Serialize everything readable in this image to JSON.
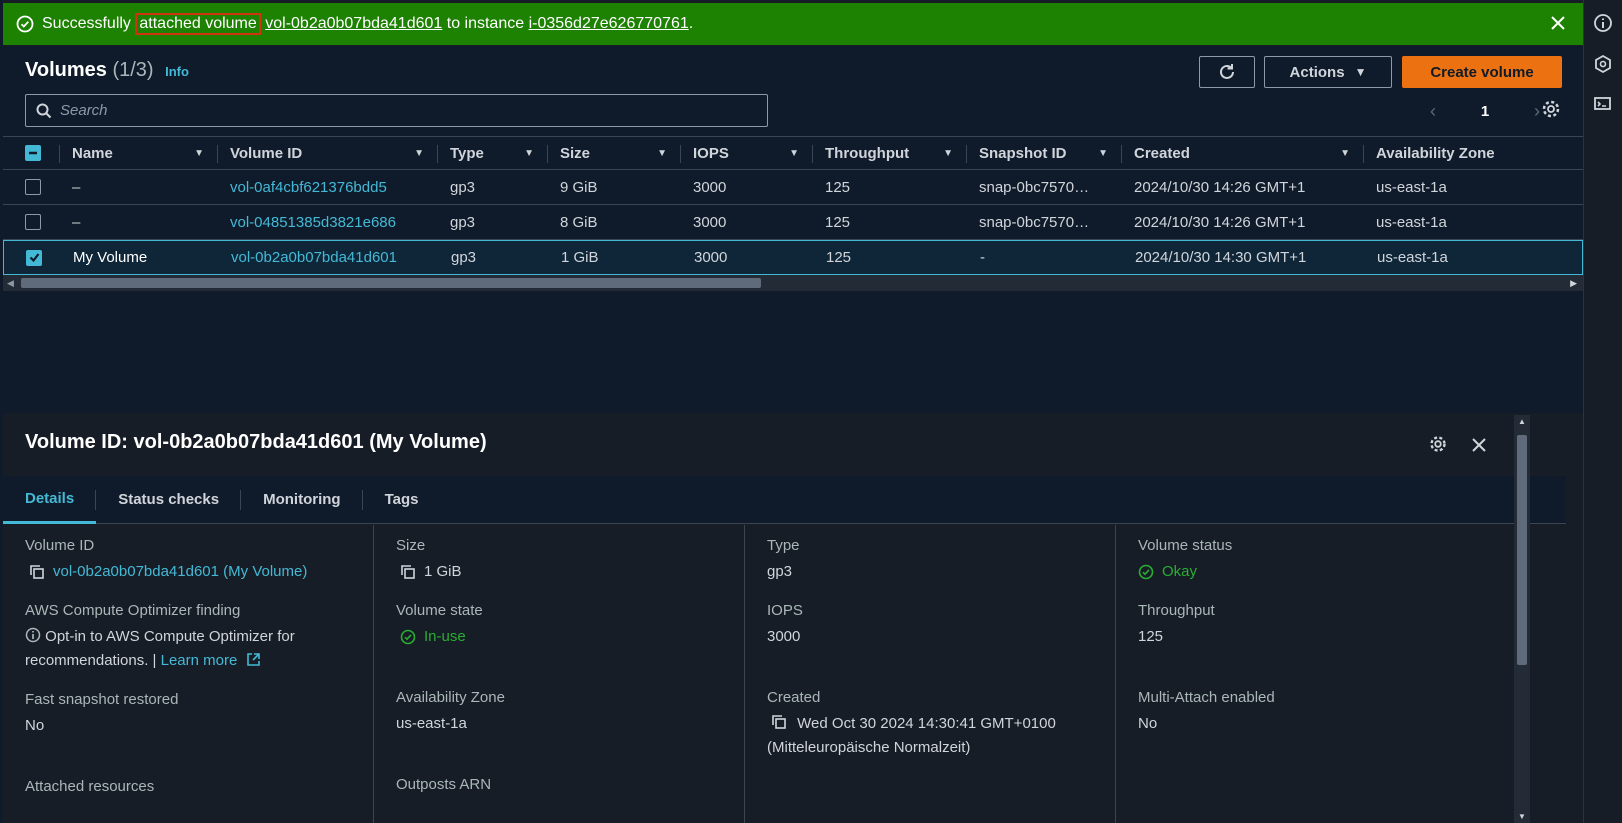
{
  "flash": {
    "prefix": "Successfully ",
    "highlight": "attached volume",
    "volume_id": "vol-0b2a0b07bda41d601",
    "mid": " to instance ",
    "instance_id": "i-0356d27e626770761",
    "suffix": "."
  },
  "header": {
    "title": "Volumes",
    "count": "(1/3)",
    "info": "Info",
    "actions_label": "Actions",
    "create_label": "Create volume",
    "search_placeholder": "Search",
    "page": "1"
  },
  "table": {
    "columns": [
      "Name",
      "Volume ID",
      "Type",
      "Size",
      "IOPS",
      "Throughput",
      "Snapshot ID",
      "Created",
      "Availability Zone"
    ],
    "rows": [
      {
        "selected": false,
        "name": "–",
        "volume_id": "vol-0af4cbf621376bdd5",
        "type": "gp3",
        "size": "9 GiB",
        "iops": "3000",
        "throughput": "125",
        "snapshot": "snap-0bc7570…",
        "created": "2024/10/30 14:26 GMT+1",
        "az": "us-east-1a"
      },
      {
        "selected": false,
        "name": "–",
        "volume_id": "vol-04851385d3821e686",
        "type": "gp3",
        "size": "8 GiB",
        "iops": "3000",
        "throughput": "125",
        "snapshot": "snap-0bc7570…",
        "created": "2024/10/30 14:26 GMT+1",
        "az": "us-east-1a"
      },
      {
        "selected": true,
        "name": "My Volume",
        "volume_id": "vol-0b2a0b07bda41d601",
        "type": "gp3",
        "size": "1 GiB",
        "iops": "3000",
        "throughput": "125",
        "snapshot": "-",
        "created": "2024/10/30 14:30 GMT+1",
        "az": "us-east-1a"
      }
    ]
  },
  "detail": {
    "title": "Volume ID: vol-0b2a0b07bda41d601 (My Volume)",
    "tabs": [
      "Details",
      "Status checks",
      "Monitoring",
      "Tags"
    ],
    "col1": {
      "volume_id_label": "Volume ID",
      "volume_id_value": "vol-0b2a0b07bda41d601 (My Volume)",
      "optimizer_label": "AWS Compute Optimizer finding",
      "optimizer_text": "Opt-in to AWS Compute Optimizer for recommendations. | ",
      "learn_more": "Learn more",
      "fast_label": "Fast snapshot restored",
      "fast_value": "No",
      "attached_label": "Attached resources"
    },
    "col2": {
      "size_label": "Size",
      "size_value": "1 GiB",
      "state_label": "Volume state",
      "state_value": "In-use",
      "az_label": "Availability Zone",
      "az_value": "us-east-1a",
      "outposts_label": "Outposts ARN"
    },
    "col3": {
      "type_label": "Type",
      "type_value": "gp3",
      "iops_label": "IOPS",
      "iops_value": "3000",
      "created_label": "Created",
      "created_value": "Wed Oct 30 2024 14:30:41 GMT+0100 (Mitteleuropäische Normalzeit)"
    },
    "col4": {
      "status_label": "Volume status",
      "status_value": "Okay",
      "throughput_label": "Throughput",
      "throughput_value": "125",
      "multi_label": "Multi-Attach enabled",
      "multi_value": "No"
    }
  },
  "icons": {
    "flash": "check-circle-icon",
    "refresh": "refresh-icon",
    "settings": "gear-icon",
    "close": "close-icon",
    "copy": "copy-icon",
    "external": "external-link-icon",
    "info": "info-icon"
  },
  "colors": {
    "success": "#1d8102",
    "link": "#44b9d6",
    "primary_button": "#ec7211",
    "ok_green": "#29ad32"
  }
}
